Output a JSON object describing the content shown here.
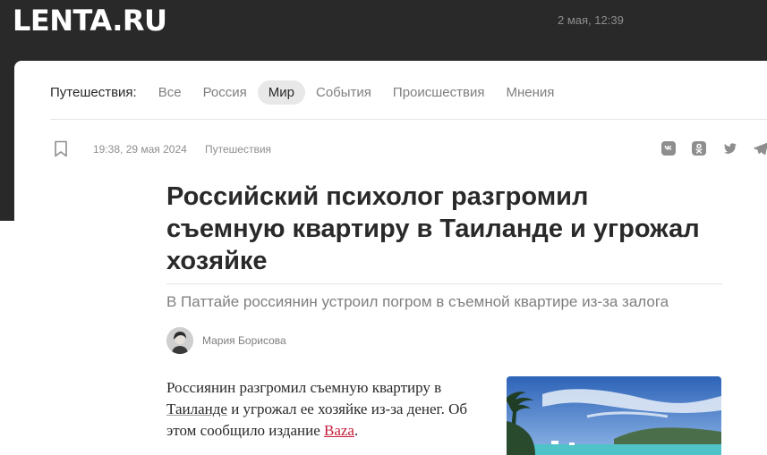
{
  "header": {
    "logo": "LENTA.RU",
    "date": "2 мая, 12:39"
  },
  "nav": {
    "label": "Путешествия:",
    "items": [
      "Все",
      "Россия",
      "Мир",
      "События",
      "Происшествия",
      "Мнения"
    ],
    "active": "Мир"
  },
  "meta": {
    "time": "19:38, 29 мая 2024",
    "rubric": "Путешествия"
  },
  "share": {
    "icons": [
      "vk-icon",
      "odnoklassniki-icon",
      "twitter-icon",
      "telegram-icon"
    ]
  },
  "article": {
    "title": "Российский психолог разгромил съемную квартиру в Таиланде и угрожал хозяйке",
    "lead": "В Паттайе россиянин устроил погром в съемной квартире из-за залога",
    "author": "Мария Борисова",
    "body": {
      "part1": "Россиянин разгромил съемную квартиру в ",
      "link1": "Таиланде",
      "part2": " и угрожал ее хозяйке из-за денег. Об этом сообщило издание ",
      "link2": "Baza",
      "part3": "."
    }
  },
  "colors": {
    "header_bg": "#292929",
    "accent_link": "#c41e3a",
    "active_tab_bg": "#e8e8e8"
  }
}
